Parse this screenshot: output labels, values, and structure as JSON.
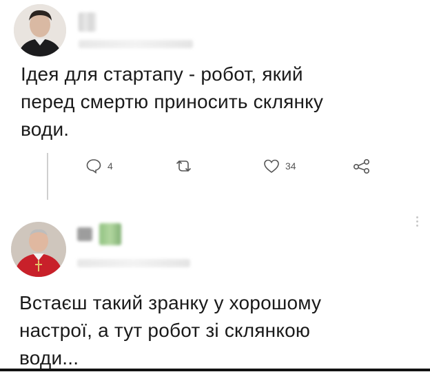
{
  "posts": [
    {
      "text": "Ідея для стартапу - робот, який\nперед смертю приносить склянку\nводи.",
      "actions": {
        "reply_count": "4",
        "retweet_count": "",
        "like_count": "34"
      }
    },
    {
      "text": "Встаєш такий зранку у хорошому\nнастрої, а тут робот зі склянкою\nводи..."
    }
  ],
  "icons": {
    "reply": "reply-icon",
    "retweet": "retweet-icon",
    "like": "heart-icon",
    "share": "share-icon",
    "more": "more-vertical-icon"
  },
  "colors": {
    "text": "#1a1a1a",
    "icon": "#555555",
    "divider": "#cfcfcf"
  }
}
